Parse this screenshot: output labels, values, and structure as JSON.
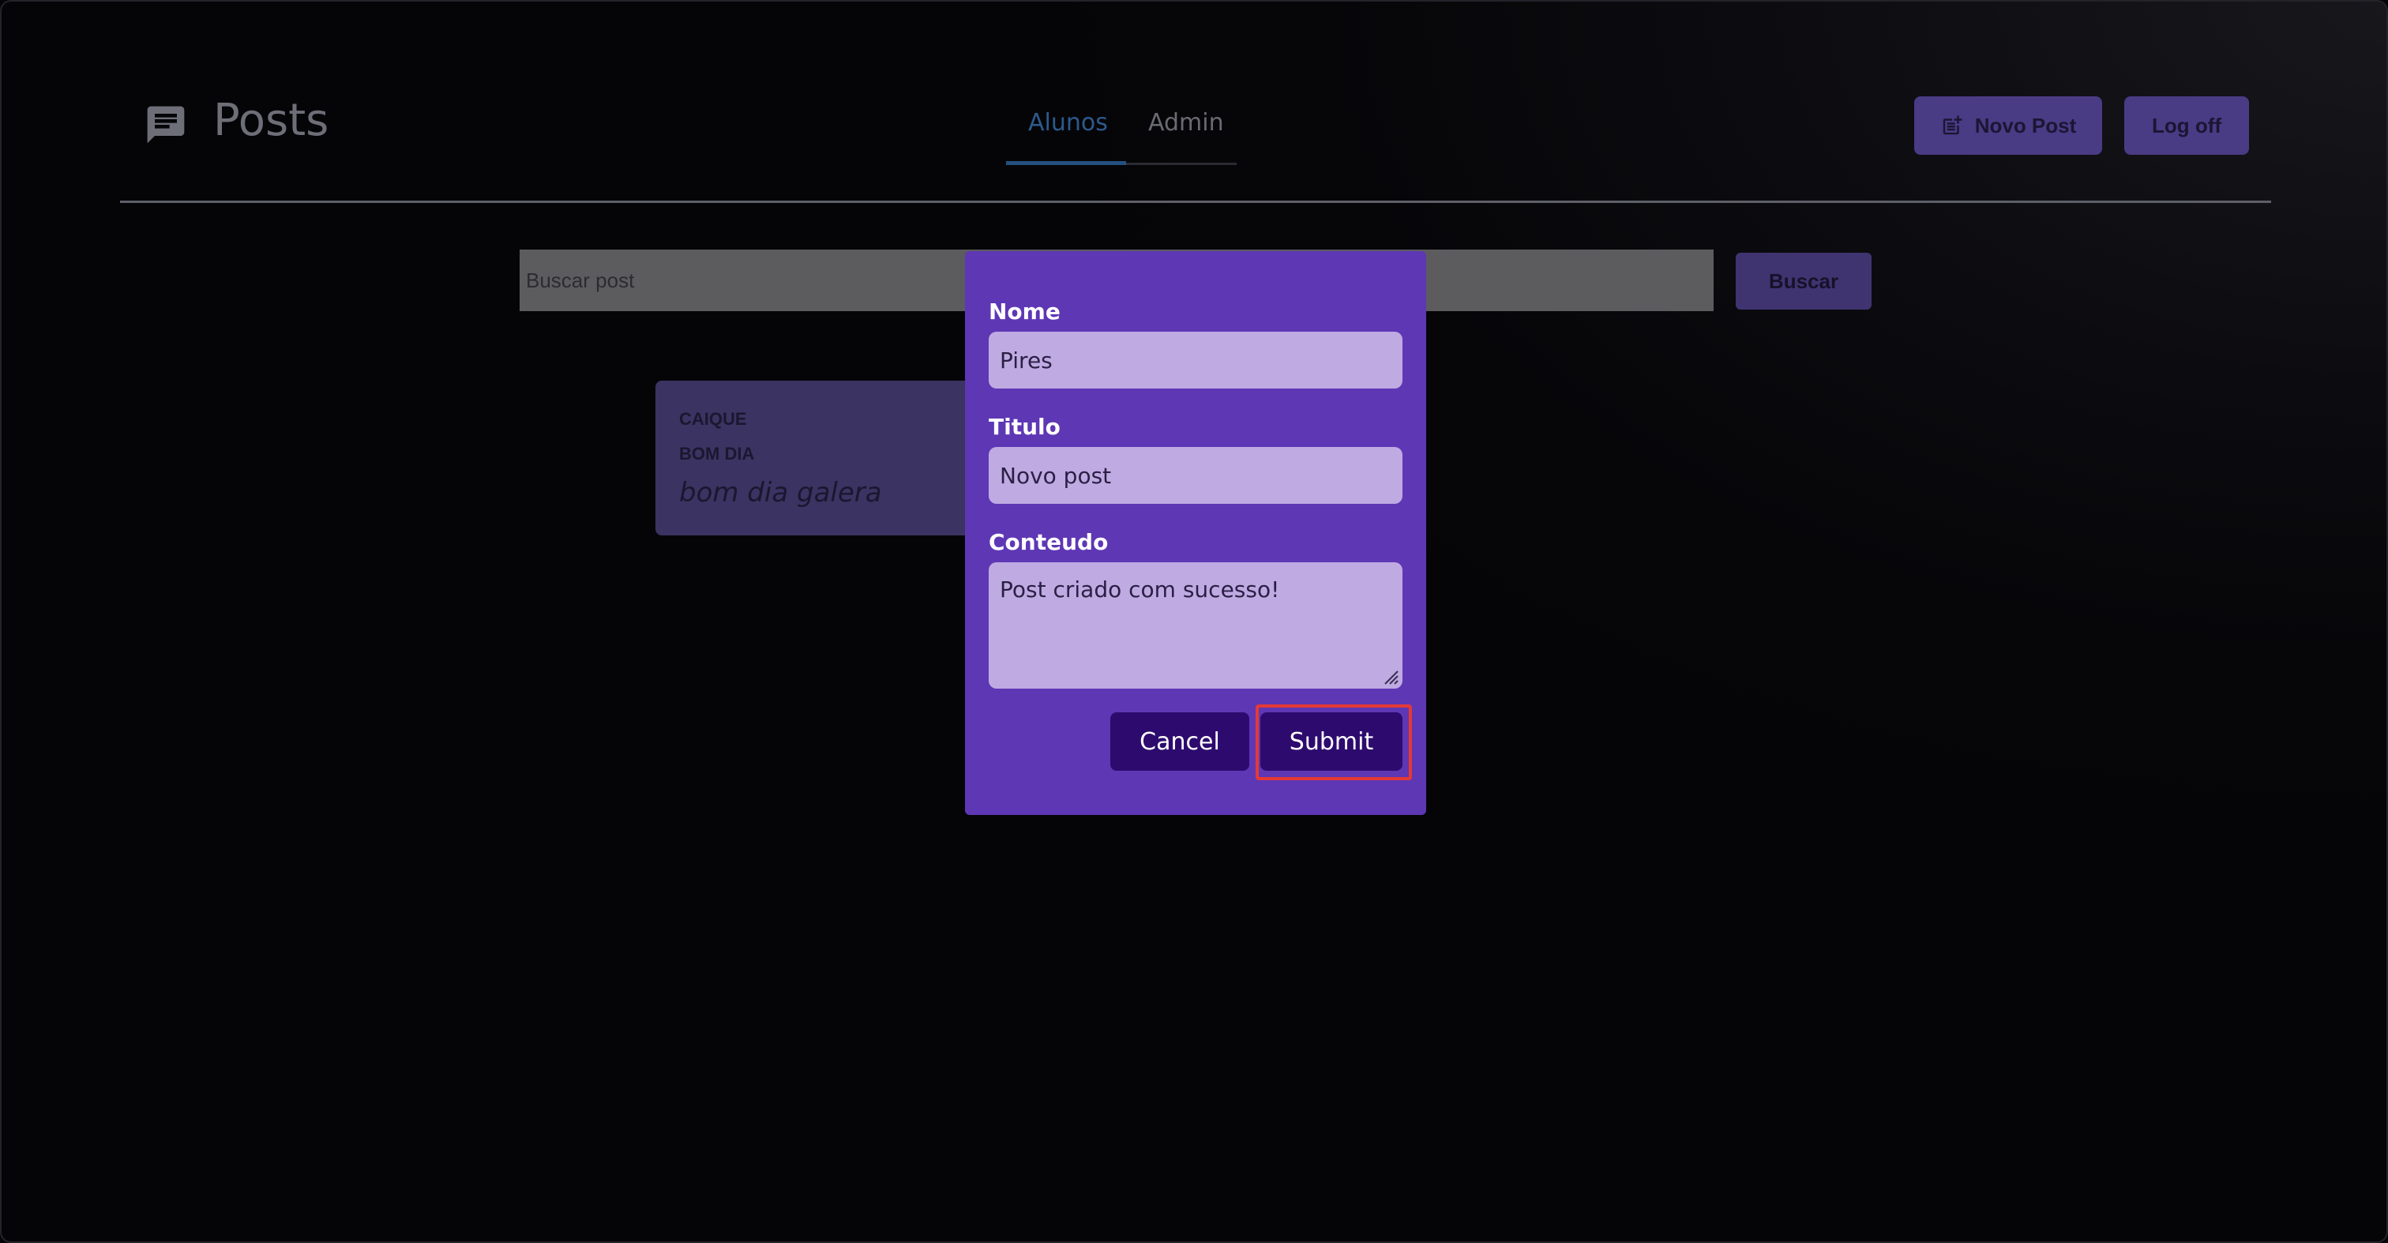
{
  "header": {
    "title": "Posts",
    "logo_icon": "chat-icon",
    "tabs": [
      {
        "label": "Alunos",
        "active": true
      },
      {
        "label": "Admin",
        "active": false
      }
    ],
    "new_post_label": "Novo Post",
    "new_post_icon": "post-add-icon",
    "logoff_label": "Log off"
  },
  "search": {
    "placeholder": "Buscar post",
    "button_label": "Buscar"
  },
  "posts": [
    {
      "author": "CAIQUE",
      "title": "BOM DIA",
      "content": "bom dia galera"
    }
  ],
  "modal": {
    "fields": {
      "nome": {
        "label": "Nome",
        "value": "Pires"
      },
      "titulo": {
        "label": "Titulo",
        "value": "Novo post"
      },
      "conteudo": {
        "label": "Conteudo",
        "value": "Post criado com sucesso!"
      }
    },
    "cancel_label": "Cancel",
    "submit_label": "Submit"
  },
  "colors": {
    "modal_bg": "#5e37b5",
    "field_bg": "#bfaae2",
    "modal_button": "#2d0b6e",
    "highlight": "#e53935",
    "active_tab": "#2d5a8c"
  }
}
